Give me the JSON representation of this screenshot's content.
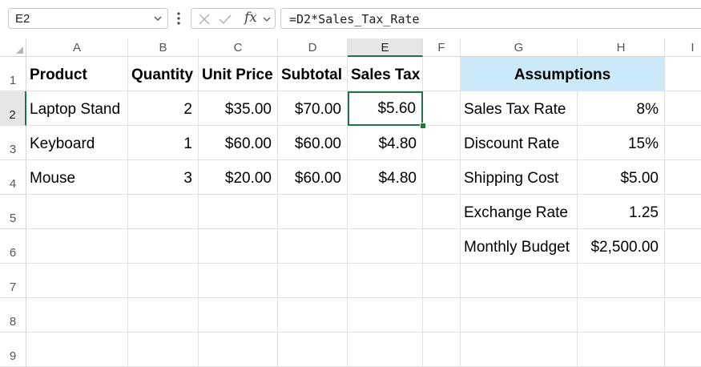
{
  "formula_bar": {
    "name_box": "E2",
    "formula": "=D2*Sales_Tax_Rate"
  },
  "columns": [
    "A",
    "B",
    "C",
    "D",
    "E",
    "F",
    "G",
    "H",
    "I"
  ],
  "rows": [
    "1",
    "2",
    "3",
    "4",
    "5",
    "6",
    "7",
    "8",
    "9"
  ],
  "cells": {
    "A1": "Product",
    "B1": "Quantity",
    "C1": "Unit Price",
    "D1": "Subtotal",
    "E1": "Sales Tax",
    "A2": "Laptop Stand",
    "B2": "2",
    "C2": "$35.00",
    "D2": "$70.00",
    "E2": "$5.60",
    "A3": "Keyboard",
    "B3": "1",
    "C3": "$60.00",
    "D3": "$60.00",
    "E3": "$4.80",
    "A4": "Mouse",
    "B4": "3",
    "C4": "$20.00",
    "D4": "$60.00",
    "E4": "$4.80",
    "G1": "Assumptions",
    "G2": "Sales Tax Rate",
    "H2": "8%",
    "G3": "Discount Rate",
    "H3": "15%",
    "G4": "Shipping Cost",
    "H4": "$5.00",
    "G5": "Exchange Rate",
    "H5": "1.25",
    "G6": "Monthly Budget",
    "H6": "$2,500.00"
  },
  "colors": {
    "accent_green": "#217346",
    "assumptions_fill": "#cbe9f8"
  },
  "selected_cell": "E2"
}
